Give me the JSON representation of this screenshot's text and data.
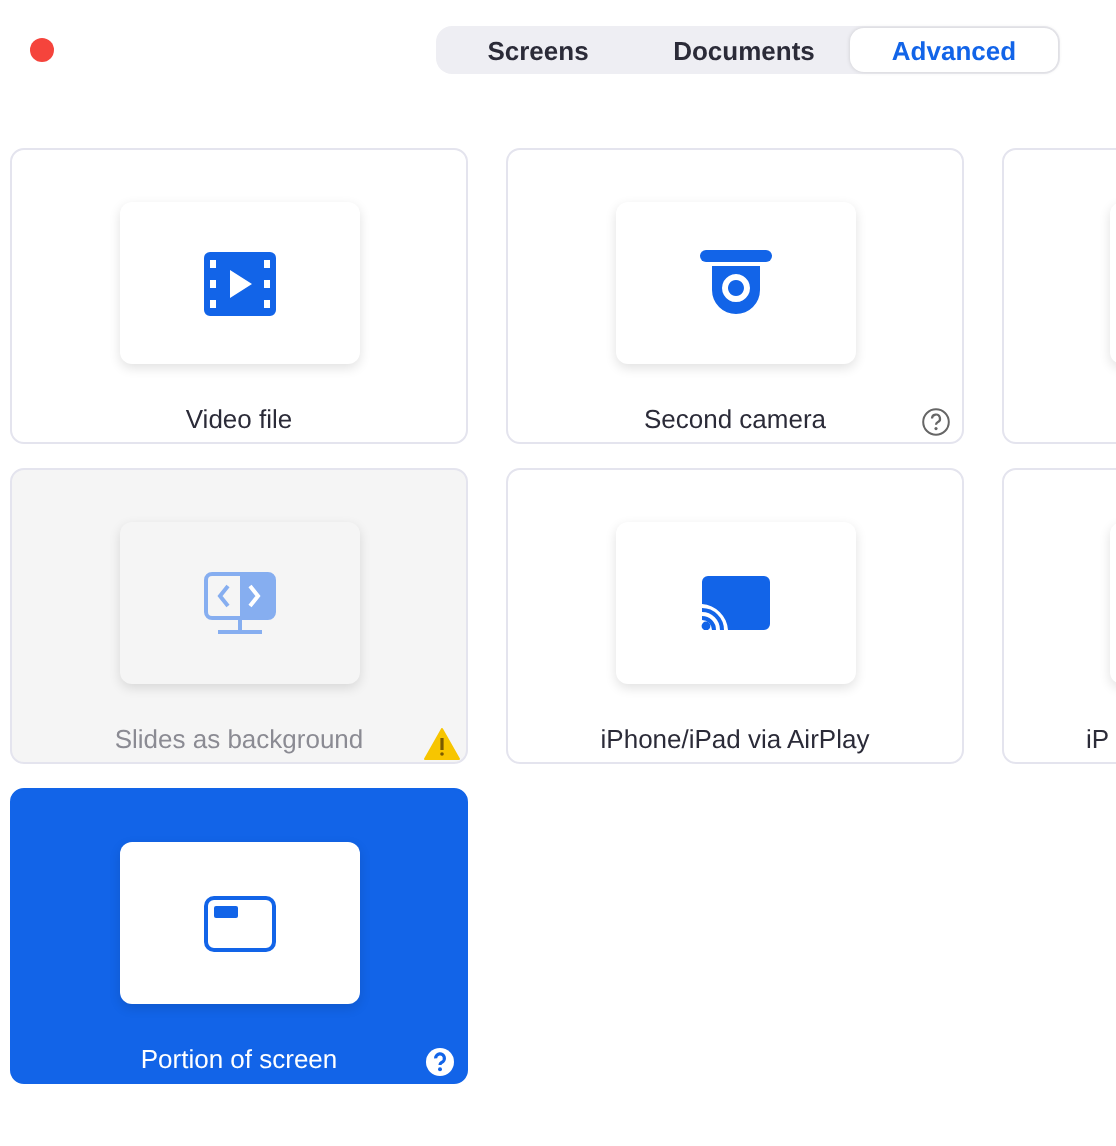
{
  "tabs": [
    {
      "label": "Screens",
      "selected": false
    },
    {
      "label": "Documents",
      "selected": false
    },
    {
      "label": "Advanced",
      "selected": true
    }
  ],
  "cards": [
    {
      "label": "Video file",
      "kind": "film",
      "selected": false,
      "disabled": false,
      "help": false,
      "warning": false
    },
    {
      "label": "Second camera",
      "kind": "camera",
      "selected": false,
      "disabled": false,
      "help": true,
      "warning": false
    },
    {
      "kind": "partial",
      "selected": false
    },
    {
      "label": "Slides as background",
      "kind": "slides",
      "selected": false,
      "disabled": true,
      "help": false,
      "warning": true
    },
    {
      "label": "iPhone/iPad via AirPlay",
      "kind": "airplay",
      "selected": false,
      "disabled": false,
      "help": false,
      "warning": false
    },
    {
      "label": "iP",
      "kind": "partial",
      "selected": false
    },
    {
      "label": "Portion of screen",
      "kind": "portion",
      "selected": true,
      "disabled": false,
      "help": true,
      "warning": false
    }
  ]
}
